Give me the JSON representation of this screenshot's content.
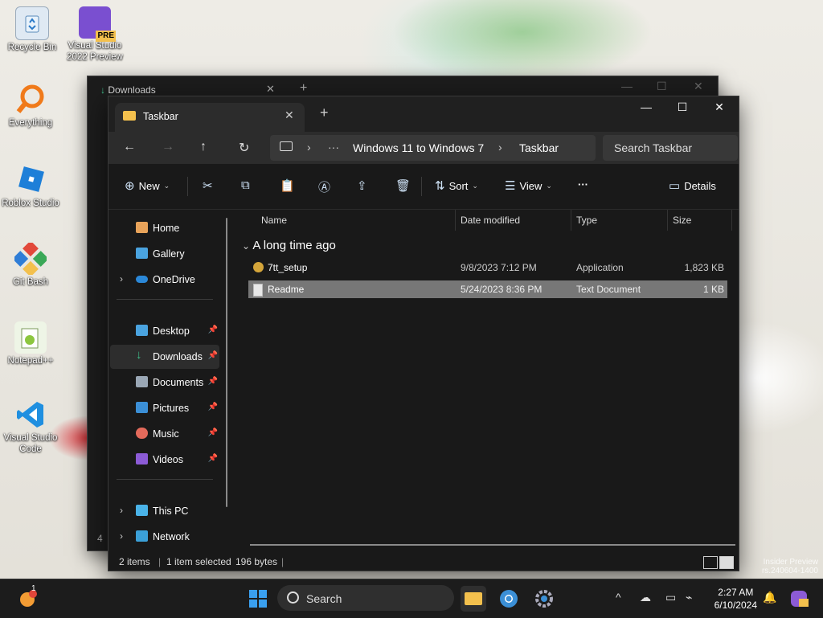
{
  "desktop": {
    "icons": [
      {
        "label": "Recycle Bin",
        "name": "recycle-bin-icon"
      },
      {
        "label": "Visual Studio 2022 Preview",
        "name": "visual-studio-preview-icon",
        "badge": "PRE"
      },
      {
        "label": "Everything",
        "name": "everything-search-icon"
      },
      {
        "label": "Roblox Studio",
        "name": "roblox-studio-icon"
      },
      {
        "label": "Git Bash",
        "name": "git-bash-icon"
      },
      {
        "label": "Notepad++",
        "name": "notepad-plus-plus-icon"
      },
      {
        "label": "Visual Studio Code",
        "name": "vscode-icon"
      }
    ],
    "watermark_line1": "Insider Preview",
    "watermark_line2": "rs.240604-1400"
  },
  "back_window": {
    "tab_title": "Downloads",
    "status_left": "4"
  },
  "window": {
    "tab_title": "Taskbar",
    "breadcrumb": [
      "Windows 11 to Windows 7",
      "Taskbar"
    ],
    "search_placeholder": "Search Taskbar",
    "toolbar": {
      "new_label": "New",
      "sort_label": "Sort",
      "view_label": "View",
      "more_label": "···",
      "details_label": "Details"
    },
    "sidebar": {
      "top": [
        {
          "label": "Home",
          "icon": "home-icon"
        },
        {
          "label": "Gallery",
          "icon": "gallery-icon"
        },
        {
          "label": "OneDrive",
          "icon": "onedrive-icon"
        }
      ],
      "pinned": [
        {
          "label": "Desktop",
          "icon": "desktop-folder-icon",
          "color": "#4aa3df"
        },
        {
          "label": "Downloads",
          "icon": "downloads-icon",
          "color": "#3fbf8a"
        },
        {
          "label": "Documents",
          "icon": "documents-icon",
          "color": "#9aa7b5"
        },
        {
          "label": "Pictures",
          "icon": "pictures-icon",
          "color": "#3b8fd6"
        },
        {
          "label": "Music",
          "icon": "music-icon",
          "color": "#e36a5b"
        },
        {
          "label": "Videos",
          "icon": "videos-icon",
          "color": "#8c5bd6"
        }
      ],
      "bottom": [
        {
          "label": "This PC",
          "icon": "this-pc-icon"
        },
        {
          "label": "Network",
          "icon": "network-icon"
        }
      ]
    },
    "columns": [
      "Name",
      "Date modified",
      "Type",
      "Size"
    ],
    "group_label": "A long time ago",
    "files": [
      {
        "name": "7tt_setup",
        "date": "9/8/2023 7:12 PM",
        "type": "Application",
        "size": "1,823 KB",
        "icon": "installer-icon"
      },
      {
        "name": "Readme",
        "date": "5/24/2023 8:36 PM",
        "type": "Text Document",
        "size": "1 KB",
        "icon": "text-file-icon"
      }
    ],
    "status": {
      "items": "2 items",
      "selected": "1 item selected",
      "bytes": "196 bytes"
    }
  },
  "taskbar": {
    "search_label": "Search",
    "time": "2:27 AM",
    "date": "6/10/2024",
    "notification_badge": "1"
  },
  "colors": {
    "accent": "#3b8fd6",
    "folder": "#f3c04d",
    "selection": "#777777"
  }
}
